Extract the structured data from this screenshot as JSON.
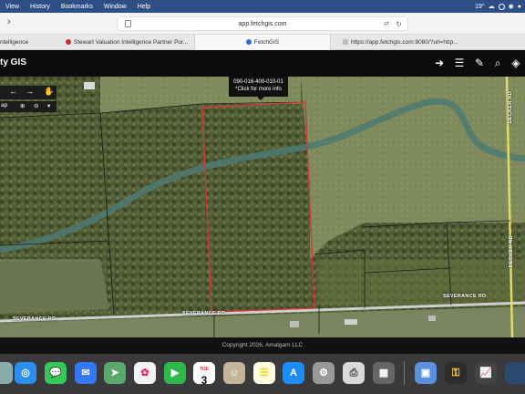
{
  "menubar": {
    "items": [
      "View",
      "History",
      "Bookmarks",
      "Window",
      "Help"
    ],
    "status_temp": "19°"
  },
  "browser": {
    "address": "app.fetchgis.com",
    "tabs": [
      {
        "label": "ntelligence"
      },
      {
        "label": "Stewart Valuation Intelligence Partner Por..."
      },
      {
        "label": "FetchGIS"
      },
      {
        "label": "https://app.fetchgis.com:8080/?url=http..."
      }
    ]
  },
  "gis": {
    "title": "ty GIS",
    "popup_parcel": "090-016-400-010-01",
    "popup_hint": "*Click for more info",
    "zoom_label": "ap",
    "road_labels": {
      "severance_left": "SEVERANCE RD",
      "severance_mid": "SEVERANCE RD",
      "severance_right": "SEVERANCE RD",
      "north_road": "DECKER RD",
      "east_road": "DECKER RD"
    },
    "copyright": "Copyright 2026, Amalgam LLC"
  },
  "dock": {
    "calendar_month": "TUE",
    "calendar_day": "3"
  },
  "colors": {
    "parcel_highlight": "#d23a32",
    "parcel_lines": "#1a1a1a",
    "menubar": "#2d4f86",
    "road": "#cfcfcf"
  }
}
